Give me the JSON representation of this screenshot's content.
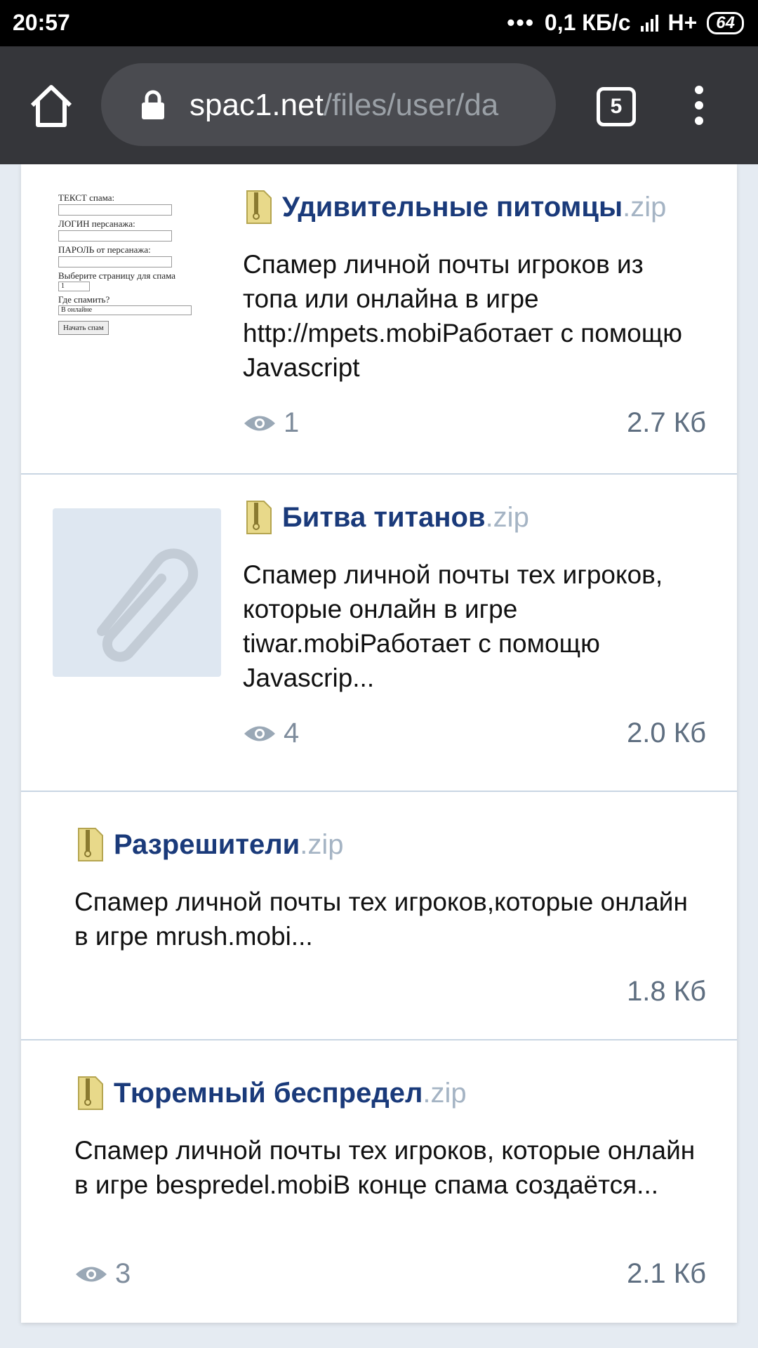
{
  "status_bar": {
    "time": "20:57",
    "dots": "•••",
    "network_speed": "0,1 КБ/с",
    "network_type": "H+",
    "battery": "64"
  },
  "browser": {
    "url_host": "spac1.net",
    "url_path": "/files/user/da",
    "tab_count": "5"
  },
  "files": [
    {
      "name": "Удивительные питомцы",
      "ext": ".zip",
      "description": "Спамер личной почты игроков из топа или онлайна в игре http://mpets.mobiРаботает с помощю Javascript",
      "views": "1",
      "size": "2.7 Кб",
      "thumb_form": {
        "label_text": "ТЕКСТ спама:",
        "label_login": "ЛОГИН персанажа:",
        "label_password": "ПАРОЛЬ от персанажа:",
        "label_page": "Выберите страницу для спама",
        "page_value": "1",
        "label_where": "Где спамить?",
        "where_value": "В онлайне",
        "button": "Начать спам"
      }
    },
    {
      "name": "Битва титанов",
      "ext": ".zip",
      "description": "Спамер личной почты тех игроков, которые онлайн в игре tiwar.mobiРаботает с помощю Javascrip...",
      "views": "4",
      "size": "2.0 Кб"
    },
    {
      "name": "Разрешители",
      "ext": ".zip",
      "description": "Спамер личной почты тех игроков,которые онлайн в игре mrush.mobi...",
      "size": "1.8 Кб"
    },
    {
      "name": "Тюремный беспредел",
      "ext": ".zip",
      "description": "Спамер личной почты тех игроков, которые онлайн в игре bespredel.mobiВ конце спама создаётся...",
      "views": "3",
      "size": "2.1 Кб"
    }
  ],
  "colors": {
    "title": "#1a3a7a",
    "ext": "#a5b4c4",
    "meta": "#5e6e80",
    "divider": "#c9d6e3"
  }
}
